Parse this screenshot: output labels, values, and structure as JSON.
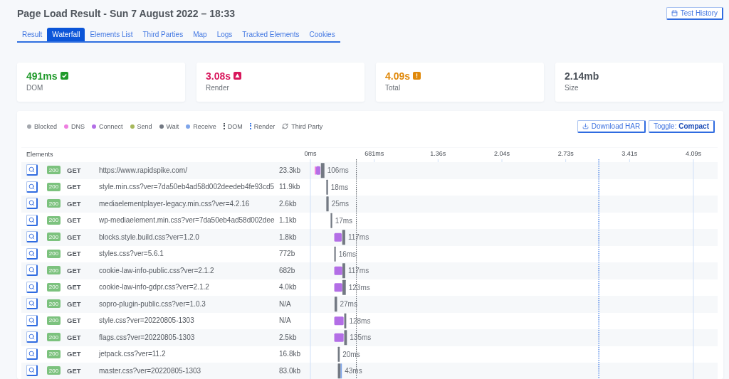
{
  "header": {
    "title": "Page Load Result - Sun 7 August 2022 – 18:33",
    "history_button": "Test History"
  },
  "tabs": [
    {
      "label": "Result",
      "selected": false
    },
    {
      "label": "Waterfall",
      "selected": true
    },
    {
      "label": "Elements List",
      "selected": false
    },
    {
      "label": "Third Parties",
      "selected": false
    },
    {
      "label": "Map",
      "selected": false
    },
    {
      "label": "Logs",
      "selected": false
    },
    {
      "label": "Tracked Elements",
      "selected": false
    },
    {
      "label": "Cookies",
      "selected": false
    }
  ],
  "metrics": [
    {
      "value": "491ms",
      "label": "DOM",
      "kind": "good"
    },
    {
      "value": "3.08s",
      "label": "Render",
      "kind": "bad"
    },
    {
      "value": "4.09s",
      "label": "Total",
      "kind": "warning"
    },
    {
      "value": "2.14mb",
      "label": "Size",
      "kind": "plain"
    }
  ],
  "waterfall": {
    "legend": [
      {
        "label": "Blocked",
        "kind": "dot",
        "color": "#a4a8ae"
      },
      {
        "label": "DNS",
        "kind": "dot",
        "color": "#ee7fe0"
      },
      {
        "label": "Connect",
        "kind": "dot",
        "color": "#b36ee6"
      },
      {
        "label": "Send",
        "kind": "dot",
        "color": "#a7b85c"
      },
      {
        "label": "Wait",
        "kind": "dot",
        "color": "#737983"
      },
      {
        "label": "Receive",
        "kind": "dot",
        "color": "#7fa5ea"
      },
      {
        "label": "DOM",
        "kind": "line",
        "color": "#4e545c"
      },
      {
        "label": "Render",
        "kind": "line",
        "color": "#3f7be6"
      },
      {
        "label": "Third Party",
        "kind": "icon"
      }
    ],
    "actions": [
      {
        "kind": "download",
        "label": "Download HAR"
      },
      {
        "kind": "toggle",
        "label": "Toggle: **Compact**"
      }
    ],
    "table": {
      "heading": "Elements",
      "axis_labels": [
        "0ms",
        "681ms",
        "1.36s",
        "2.04s",
        "2.73s",
        "3.41s",
        "4.09s"
      ],
      "rows": [
        {
          "status": "200",
          "method": "GET",
          "url": "https://www.rapidspike.com/",
          "size": "23.3kb",
          "duration": "106ms"
        },
        {
          "status": "200",
          "method": "GET",
          "url": "style.min.css?ver=7da50eb4ad58d002deedeb4fe93cd5",
          "size": "11.9kb",
          "duration": "18ms"
        },
        {
          "status": "200",
          "method": "GET",
          "url": "mediaelementplayer-legacy.min.css?ver=4.2.16",
          "size": "2.6kb",
          "duration": "25ms"
        },
        {
          "status": "200",
          "method": "GET",
          "url": "wp-mediaelement.min.css?ver=7da50eb4ad58d002dee",
          "size": "1.1kb",
          "duration": "17ms"
        },
        {
          "status": "200",
          "method": "GET",
          "url": "blocks.style.build.css?ver=1.2.0",
          "size": "1.8kb",
          "duration": "117ms"
        },
        {
          "status": "200",
          "method": "GET",
          "url": "styles.css?ver=5.6.1",
          "size": "772b",
          "duration": "16ms"
        },
        {
          "status": "200",
          "method": "GET",
          "url": "cookie-law-info-public.css?ver=2.1.2",
          "size": "682b",
          "duration": "117ms"
        },
        {
          "status": "200",
          "method": "GET",
          "url": "cookie-law-info-gdpr.css?ver=2.1.2",
          "size": "4.0kb",
          "duration": "123ms"
        },
        {
          "status": "200",
          "method": "GET",
          "url": "sopro-plugin-public.css?ver=1.0.3",
          "size": "N/A",
          "duration": "27ms"
        },
        {
          "status": "200",
          "method": "GET",
          "url": "style.css?ver=20220805-1303",
          "size": "N/A",
          "duration": "128ms"
        },
        {
          "status": "200",
          "method": "GET",
          "url": "flags.css?ver=20220805-1303",
          "size": "2.5kb",
          "duration": "135ms"
        },
        {
          "status": "200",
          "method": "GET",
          "url": "jetpack.css?ver=11.2",
          "size": "16.8kb",
          "duration": "20ms"
        },
        {
          "status": "200",
          "method": "GET",
          "url": "master.css?ver=20220805-1303",
          "size": "83.0kb",
          "duration": "43ms"
        }
      ]
    }
  }
}
